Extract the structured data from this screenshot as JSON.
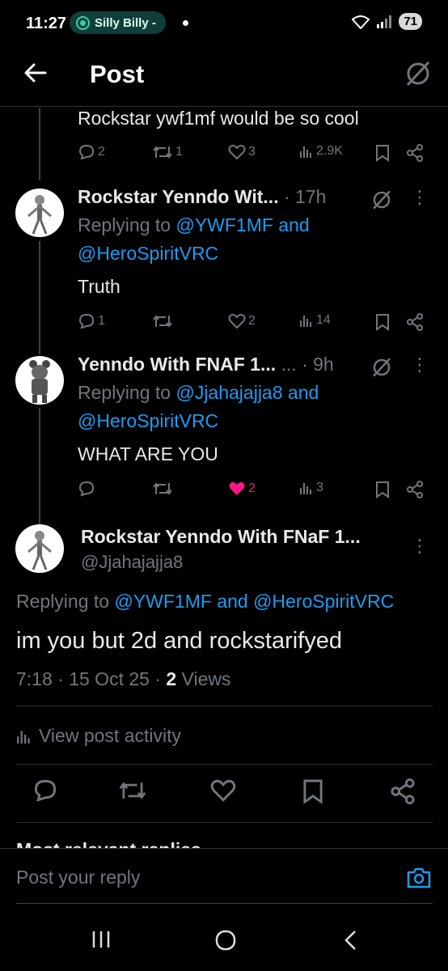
{
  "status_bar": {
    "time": "11:27",
    "notification_pill": "Silly Billy -",
    "battery": "71"
  },
  "header": {
    "title": "Post"
  },
  "posts": [
    {
      "text": "Rockstar ywf1mf would be so cool",
      "replies": "2",
      "reposts": "1",
      "likes": "3",
      "views": "2.9K"
    },
    {
      "name": "Rockstar Yenndo Wit...",
      "time": "· 17h",
      "replying_prefix": "Replying to ",
      "mention1": "@YWF1MF",
      "and": " and",
      "mention2": "@HeroSpiritVRC",
      "text": "Truth",
      "replies": "1",
      "reposts": "",
      "likes": "2",
      "views": "14"
    },
    {
      "name": "Yenndo With FNAF 1...",
      "time": "... · 9h",
      "replying_prefix": "Replying to ",
      "mention1": "@Jjahajajja8",
      "and": " and",
      "mention2": "@HeroSpiritVRC",
      "text": "WHAT ARE YOU",
      "replies": "",
      "reposts": "",
      "likes": "2",
      "views": "3"
    }
  ],
  "main_post": {
    "name": "Rockstar Yenndo With FNaF 1...",
    "handle": "@Jjahajajja8",
    "replying_prefix": "Replying to ",
    "mention1": "@YWF1MF",
    "and": " and ",
    "mention2": "@HeroSpiritVRC",
    "text": "im you but 2d and rockstarifyed",
    "timestamp": "7:18 · 15 Oct 25 · ",
    "views_count": "2",
    "views_label": " Views",
    "activity_label": "View post activity"
  },
  "replies_section": {
    "heading": "Most relevant replies"
  },
  "reply_bar": {
    "placeholder": "Post your reply"
  },
  "colors": {
    "accent": "#1d9bf0",
    "like": "#f91880",
    "muted": "#71767b",
    "text": "#e7e9ea"
  }
}
